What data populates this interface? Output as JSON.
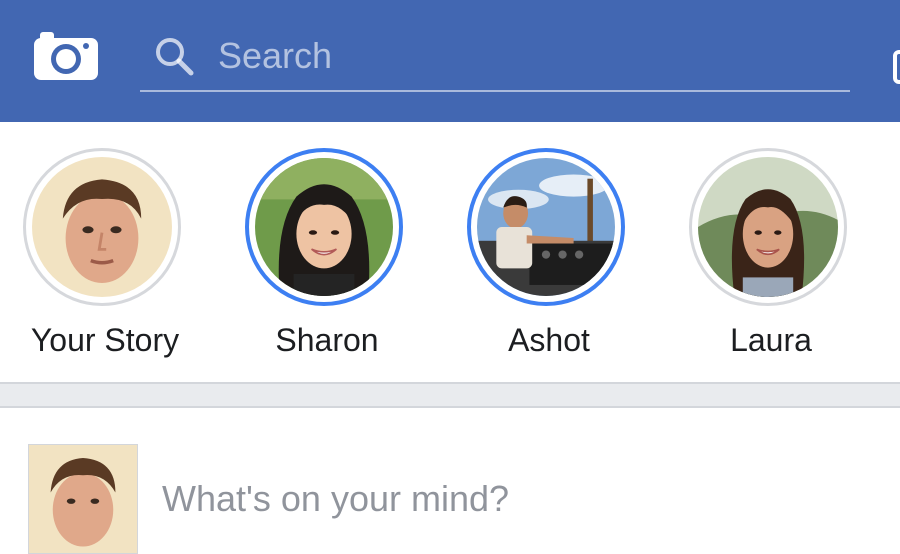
{
  "header": {
    "camera_icon": "camera-icon",
    "search": {
      "icon": "search-icon",
      "placeholder": "Search",
      "value": ""
    },
    "edge_icon": "messenger-icon-partial"
  },
  "stories": [
    {
      "name": "Your Story",
      "seen": true,
      "avatar": "avatar-your-story"
    },
    {
      "name": "Sharon",
      "seen": false,
      "avatar": "avatar-sharon"
    },
    {
      "name": "Ashot",
      "seen": false,
      "avatar": "avatar-ashot"
    },
    {
      "name": "Laura",
      "seen": true,
      "avatar": "avatar-laura"
    }
  ],
  "composer": {
    "prompt": "What's on your mind?",
    "avatar": "avatar-your-profile"
  },
  "colors": {
    "header_blue": "#4267b2",
    "story_ring_unseen": "#3d7ff2",
    "story_ring_seen": "#d6d8dc",
    "divider": "#e9ebee",
    "prompt_text": "#90949c"
  }
}
